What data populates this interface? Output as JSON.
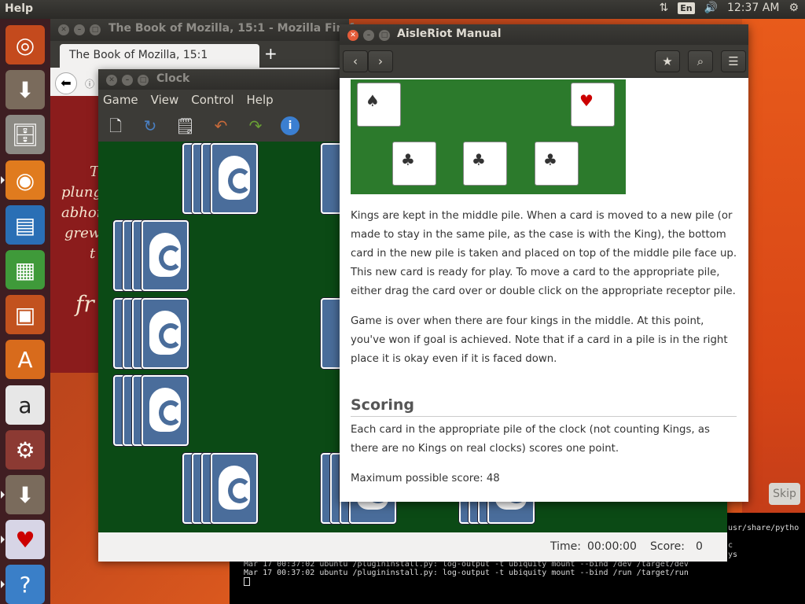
{
  "top_panel": {
    "app_name": "Help",
    "keyboard": "En",
    "time": "12:37 AM"
  },
  "launcher": {
    "items": [
      {
        "name": "dash",
        "icon": "ubuntu-logo-icon"
      },
      {
        "name": "installer",
        "icon": "installer-icon"
      },
      {
        "name": "files",
        "icon": "files-icon"
      },
      {
        "name": "firefox",
        "icon": "firefox-icon"
      },
      {
        "name": "writer",
        "icon": "writer-icon"
      },
      {
        "name": "calc",
        "icon": "calc-icon"
      },
      {
        "name": "impress",
        "icon": "impress-icon"
      },
      {
        "name": "software",
        "icon": "software-center-icon"
      },
      {
        "name": "amazon",
        "icon": "amazon-icon"
      },
      {
        "name": "settings",
        "icon": "settings-icon"
      },
      {
        "name": "installer2",
        "icon": "installer-icon"
      },
      {
        "name": "aisleriot",
        "icon": "cards-icon"
      },
      {
        "name": "help",
        "icon": "help-icon"
      }
    ]
  },
  "firefox": {
    "window_title": "The Book of Mozilla, 15:1 - Mozilla Firefox",
    "tab_title": "The Book of Mozilla, 15:1",
    "new_tab": "+",
    "page_lines": [
      "T",
      "plung",
      "abhor",
      "grew",
      "t",
      "fr"
    ]
  },
  "clock": {
    "window_title": "Clock",
    "menu": [
      "Game",
      "View",
      "Control",
      "Help"
    ],
    "status": {
      "time_label": "Time:",
      "time_value": "00:00:00",
      "score_label": "Score:",
      "score_value": "0"
    }
  },
  "manual": {
    "window_title": "AisleRiot Manual",
    "paragraphs": [
      "Kings are kept in the middle pile. When a card is moved to a new pile (or made to stay in the same pile, as the case is with the King), the bottom card in the new pile is taken and placed on top of the middle pile face up. This new card is ready for play. To move a card to the appropriate pile, either drag the card over or double click on the appropriate receptor pile.",
      "Game is over when there are four kings in the middle. At this point, you've won if goal is achieved. Note that if a card in a pile is in the right place it is okay even if it is faced down."
    ],
    "scoring_title": "Scoring",
    "scoring_text": "Each card in the appropriate pile of the clock (not counting Kings, as there are no Kings on real clocks) scores one point.",
    "max_score": "Maximum possible score: 48"
  },
  "installer": {
    "skip_label": "Skip",
    "terminal_lines": [
      "usr/share/pytho",
      "c",
      "ys",
      "Mar 17 00:37:02 ubuntu /plugininstall.py: log-output -t ubiquity mount --bind /dev /target/dev",
      "Mar 17 00:37:02 ubuntu /plugininstall.py: log-output -t ubiquity mount --bind /run /target/run"
    ]
  }
}
